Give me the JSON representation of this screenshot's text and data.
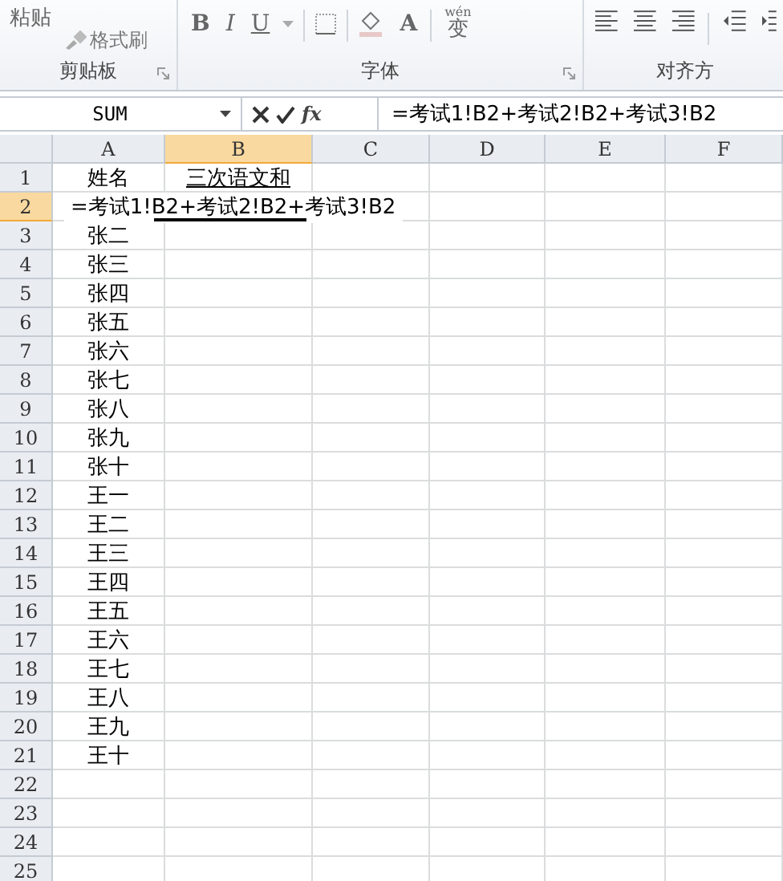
{
  "ribbon": {
    "groups": [
      {
        "kind": "clipboard",
        "label": "剪贴板",
        "paste": "粘贴",
        "format_painter": "格式刷"
      },
      {
        "kind": "font",
        "label": "字体",
        "bold": "B",
        "italic": "I",
        "underline": "U",
        "font_color": "A",
        "phonetic_top": "wén",
        "phonetic_char": "变"
      },
      {
        "kind": "align",
        "label": "对齐方"
      }
    ]
  },
  "formula_bar": {
    "name_box": "SUM",
    "fx": "fx",
    "formula": "=考试1!B2+考试2!B2+考试3!B2"
  },
  "sheet": {
    "columns": [
      {
        "label": "A",
        "selected": false
      },
      {
        "label": "B",
        "selected": true
      },
      {
        "label": "C",
        "selected": false
      },
      {
        "label": "D",
        "selected": false
      },
      {
        "label": "E",
        "selected": false
      },
      {
        "label": "F",
        "selected": false
      }
    ],
    "rows": [
      {
        "label": "1",
        "selected": false,
        "cells": [
          "姓名",
          "三次语文和"
        ]
      },
      {
        "label": "2",
        "selected": true,
        "cells": [],
        "editing": "=考试1!B2+考试2!B2+考试3!B2"
      },
      {
        "label": "3",
        "selected": false,
        "cells": [
          "张二"
        ]
      },
      {
        "label": "4",
        "selected": false,
        "cells": [
          "张三"
        ]
      },
      {
        "label": "5",
        "selected": false,
        "cells": [
          "张四"
        ]
      },
      {
        "label": "6",
        "selected": false,
        "cells": [
          "张五"
        ]
      },
      {
        "label": "7",
        "selected": false,
        "cells": [
          "张六"
        ]
      },
      {
        "label": "8",
        "selected": false,
        "cells": [
          "张七"
        ]
      },
      {
        "label": "9",
        "selected": false,
        "cells": [
          "张八"
        ]
      },
      {
        "label": "10",
        "selected": false,
        "cells": [
          "张九"
        ]
      },
      {
        "label": "11",
        "selected": false,
        "cells": [
          "张十"
        ]
      },
      {
        "label": "12",
        "selected": false,
        "cells": [
          "王一"
        ]
      },
      {
        "label": "13",
        "selected": false,
        "cells": [
          "王二"
        ]
      },
      {
        "label": "14",
        "selected": false,
        "cells": [
          "王三"
        ]
      },
      {
        "label": "15",
        "selected": false,
        "cells": [
          "王四"
        ]
      },
      {
        "label": "16",
        "selected": false,
        "cells": [
          "王五"
        ]
      },
      {
        "label": "17",
        "selected": false,
        "cells": [
          "王六"
        ]
      },
      {
        "label": "18",
        "selected": false,
        "cells": [
          "王七"
        ]
      },
      {
        "label": "19",
        "selected": false,
        "cells": [
          "王八"
        ]
      },
      {
        "label": "20",
        "selected": false,
        "cells": [
          "王九"
        ]
      },
      {
        "label": "21",
        "selected": false,
        "cells": [
          "王十"
        ]
      },
      {
        "label": "22",
        "selected": false,
        "cells": []
      },
      {
        "label": "23",
        "selected": false,
        "cells": []
      },
      {
        "label": "24",
        "selected": false,
        "cells": []
      },
      {
        "label": "25",
        "selected": false,
        "cells": []
      }
    ]
  }
}
